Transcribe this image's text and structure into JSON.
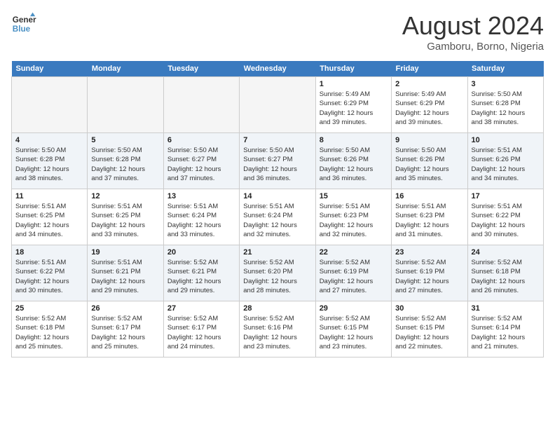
{
  "header": {
    "logo_line1": "General",
    "logo_line2": "Blue",
    "month_title": "August 2024",
    "location": "Gamboru, Borno, Nigeria"
  },
  "weekdays": [
    "Sunday",
    "Monday",
    "Tuesday",
    "Wednesday",
    "Thursday",
    "Friday",
    "Saturday"
  ],
  "weeks": [
    [
      {
        "day": "",
        "info": ""
      },
      {
        "day": "",
        "info": ""
      },
      {
        "day": "",
        "info": ""
      },
      {
        "day": "",
        "info": ""
      },
      {
        "day": "1",
        "info": "Sunrise: 5:49 AM\nSunset: 6:29 PM\nDaylight: 12 hours\nand 39 minutes."
      },
      {
        "day": "2",
        "info": "Sunrise: 5:49 AM\nSunset: 6:29 PM\nDaylight: 12 hours\nand 39 minutes."
      },
      {
        "day": "3",
        "info": "Sunrise: 5:50 AM\nSunset: 6:28 PM\nDaylight: 12 hours\nand 38 minutes."
      }
    ],
    [
      {
        "day": "4",
        "info": "Sunrise: 5:50 AM\nSunset: 6:28 PM\nDaylight: 12 hours\nand 38 minutes."
      },
      {
        "day": "5",
        "info": "Sunrise: 5:50 AM\nSunset: 6:28 PM\nDaylight: 12 hours\nand 37 minutes."
      },
      {
        "day": "6",
        "info": "Sunrise: 5:50 AM\nSunset: 6:27 PM\nDaylight: 12 hours\nand 37 minutes."
      },
      {
        "day": "7",
        "info": "Sunrise: 5:50 AM\nSunset: 6:27 PM\nDaylight: 12 hours\nand 36 minutes."
      },
      {
        "day": "8",
        "info": "Sunrise: 5:50 AM\nSunset: 6:26 PM\nDaylight: 12 hours\nand 36 minutes."
      },
      {
        "day": "9",
        "info": "Sunrise: 5:50 AM\nSunset: 6:26 PM\nDaylight: 12 hours\nand 35 minutes."
      },
      {
        "day": "10",
        "info": "Sunrise: 5:51 AM\nSunset: 6:26 PM\nDaylight: 12 hours\nand 34 minutes."
      }
    ],
    [
      {
        "day": "11",
        "info": "Sunrise: 5:51 AM\nSunset: 6:25 PM\nDaylight: 12 hours\nand 34 minutes."
      },
      {
        "day": "12",
        "info": "Sunrise: 5:51 AM\nSunset: 6:25 PM\nDaylight: 12 hours\nand 33 minutes."
      },
      {
        "day": "13",
        "info": "Sunrise: 5:51 AM\nSunset: 6:24 PM\nDaylight: 12 hours\nand 33 minutes."
      },
      {
        "day": "14",
        "info": "Sunrise: 5:51 AM\nSunset: 6:24 PM\nDaylight: 12 hours\nand 32 minutes."
      },
      {
        "day": "15",
        "info": "Sunrise: 5:51 AM\nSunset: 6:23 PM\nDaylight: 12 hours\nand 32 minutes."
      },
      {
        "day": "16",
        "info": "Sunrise: 5:51 AM\nSunset: 6:23 PM\nDaylight: 12 hours\nand 31 minutes."
      },
      {
        "day": "17",
        "info": "Sunrise: 5:51 AM\nSunset: 6:22 PM\nDaylight: 12 hours\nand 30 minutes."
      }
    ],
    [
      {
        "day": "18",
        "info": "Sunrise: 5:51 AM\nSunset: 6:22 PM\nDaylight: 12 hours\nand 30 minutes."
      },
      {
        "day": "19",
        "info": "Sunrise: 5:51 AM\nSunset: 6:21 PM\nDaylight: 12 hours\nand 29 minutes."
      },
      {
        "day": "20",
        "info": "Sunrise: 5:52 AM\nSunset: 6:21 PM\nDaylight: 12 hours\nand 29 minutes."
      },
      {
        "day": "21",
        "info": "Sunrise: 5:52 AM\nSunset: 6:20 PM\nDaylight: 12 hours\nand 28 minutes."
      },
      {
        "day": "22",
        "info": "Sunrise: 5:52 AM\nSunset: 6:19 PM\nDaylight: 12 hours\nand 27 minutes."
      },
      {
        "day": "23",
        "info": "Sunrise: 5:52 AM\nSunset: 6:19 PM\nDaylight: 12 hours\nand 27 minutes."
      },
      {
        "day": "24",
        "info": "Sunrise: 5:52 AM\nSunset: 6:18 PM\nDaylight: 12 hours\nand 26 minutes."
      }
    ],
    [
      {
        "day": "25",
        "info": "Sunrise: 5:52 AM\nSunset: 6:18 PM\nDaylight: 12 hours\nand 25 minutes."
      },
      {
        "day": "26",
        "info": "Sunrise: 5:52 AM\nSunset: 6:17 PM\nDaylight: 12 hours\nand 25 minutes."
      },
      {
        "day": "27",
        "info": "Sunrise: 5:52 AM\nSunset: 6:17 PM\nDaylight: 12 hours\nand 24 minutes."
      },
      {
        "day": "28",
        "info": "Sunrise: 5:52 AM\nSunset: 6:16 PM\nDaylight: 12 hours\nand 23 minutes."
      },
      {
        "day": "29",
        "info": "Sunrise: 5:52 AM\nSunset: 6:15 PM\nDaylight: 12 hours\nand 23 minutes."
      },
      {
        "day": "30",
        "info": "Sunrise: 5:52 AM\nSunset: 6:15 PM\nDaylight: 12 hours\nand 22 minutes."
      },
      {
        "day": "31",
        "info": "Sunrise: 5:52 AM\nSunset: 6:14 PM\nDaylight: 12 hours\nand 21 minutes."
      }
    ]
  ]
}
